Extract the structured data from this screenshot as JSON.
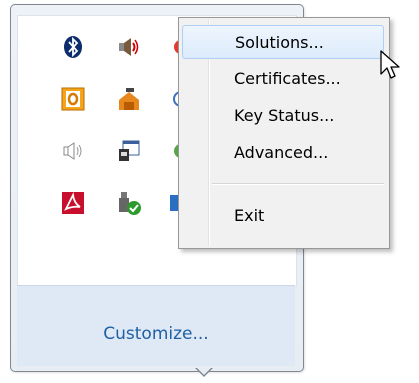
{
  "tray": {
    "customize_label": "Customize...",
    "icons": [
      "bluetooth-icon",
      "speaker-icon",
      "outlook-icon",
      "network-share-icon",
      "volume-icon",
      "program-window-icon",
      "adobe-reader-icon",
      "usb-device-check-icon"
    ]
  },
  "context_menu": {
    "items": [
      {
        "label": "Solutions...",
        "highlighted": true
      },
      {
        "label": "Certificates..."
      },
      {
        "label": "Key Status..."
      },
      {
        "label": "Advanced..."
      },
      {
        "label": "Exit"
      }
    ]
  },
  "colors": {
    "highlight": "#dcebfc",
    "customize_link": "#1f5fa3"
  }
}
